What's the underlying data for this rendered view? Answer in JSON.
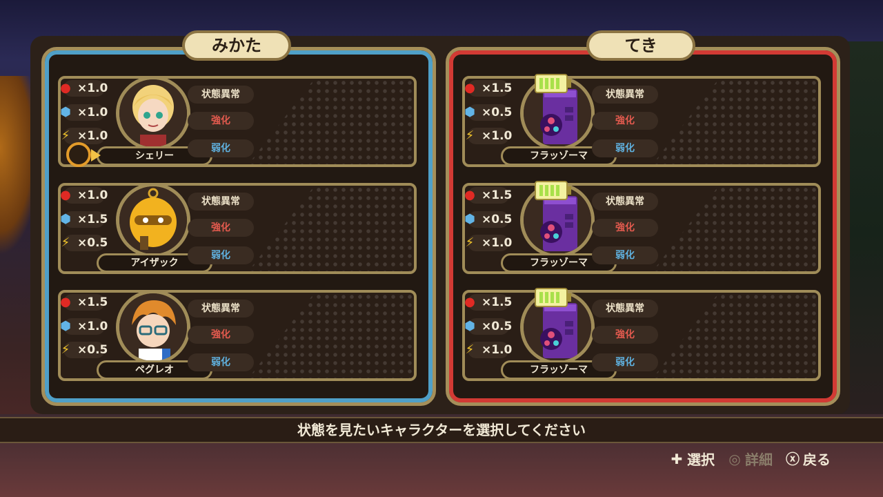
{
  "panels": {
    "ally_title": "みかた",
    "enemy_title": "てき"
  },
  "status_labels": {
    "abnormal": "状態異常",
    "buff": "強化",
    "debuff": "弱化"
  },
  "allies": [
    {
      "name": "シェリー",
      "fire": "×1.0",
      "ice": "×1.0",
      "bolt": "×1.0",
      "portrait": "girl-blonde-portrait"
    },
    {
      "name": "アイザック",
      "fire": "×1.0",
      "ice": "×1.5",
      "bolt": "×0.5",
      "portrait": "yellow-robot-portrait"
    },
    {
      "name": "ペグレオ",
      "fire": "×1.5",
      "ice": "×1.0",
      "bolt": "×0.5",
      "portrait": "boy-glasses-portrait"
    }
  ],
  "enemies": [
    {
      "name": "フラッゾーマ",
      "fire": "×1.5",
      "ice": "×0.5",
      "bolt": "×1.0",
      "portrait": "purple-machine-portrait"
    },
    {
      "name": "フラッゾーマ",
      "fire": "×1.5",
      "ice": "×0.5",
      "bolt": "×1.0",
      "portrait": "purple-machine-portrait"
    },
    {
      "name": "フラッゾーマ",
      "fire": "×1.5",
      "ice": "×0.5",
      "bolt": "×1.0",
      "portrait": "purple-machine-portrait"
    }
  ],
  "message": "状態を見たいキャラクターを選択してください",
  "hints": {
    "select": "選択",
    "details": "詳細",
    "back": "戻る"
  },
  "colors": {
    "ally_border": "#4fa0c8",
    "enemy_border": "#d23a34",
    "buff_text": "#e25a4e",
    "debuff_text": "#5fb0de"
  }
}
